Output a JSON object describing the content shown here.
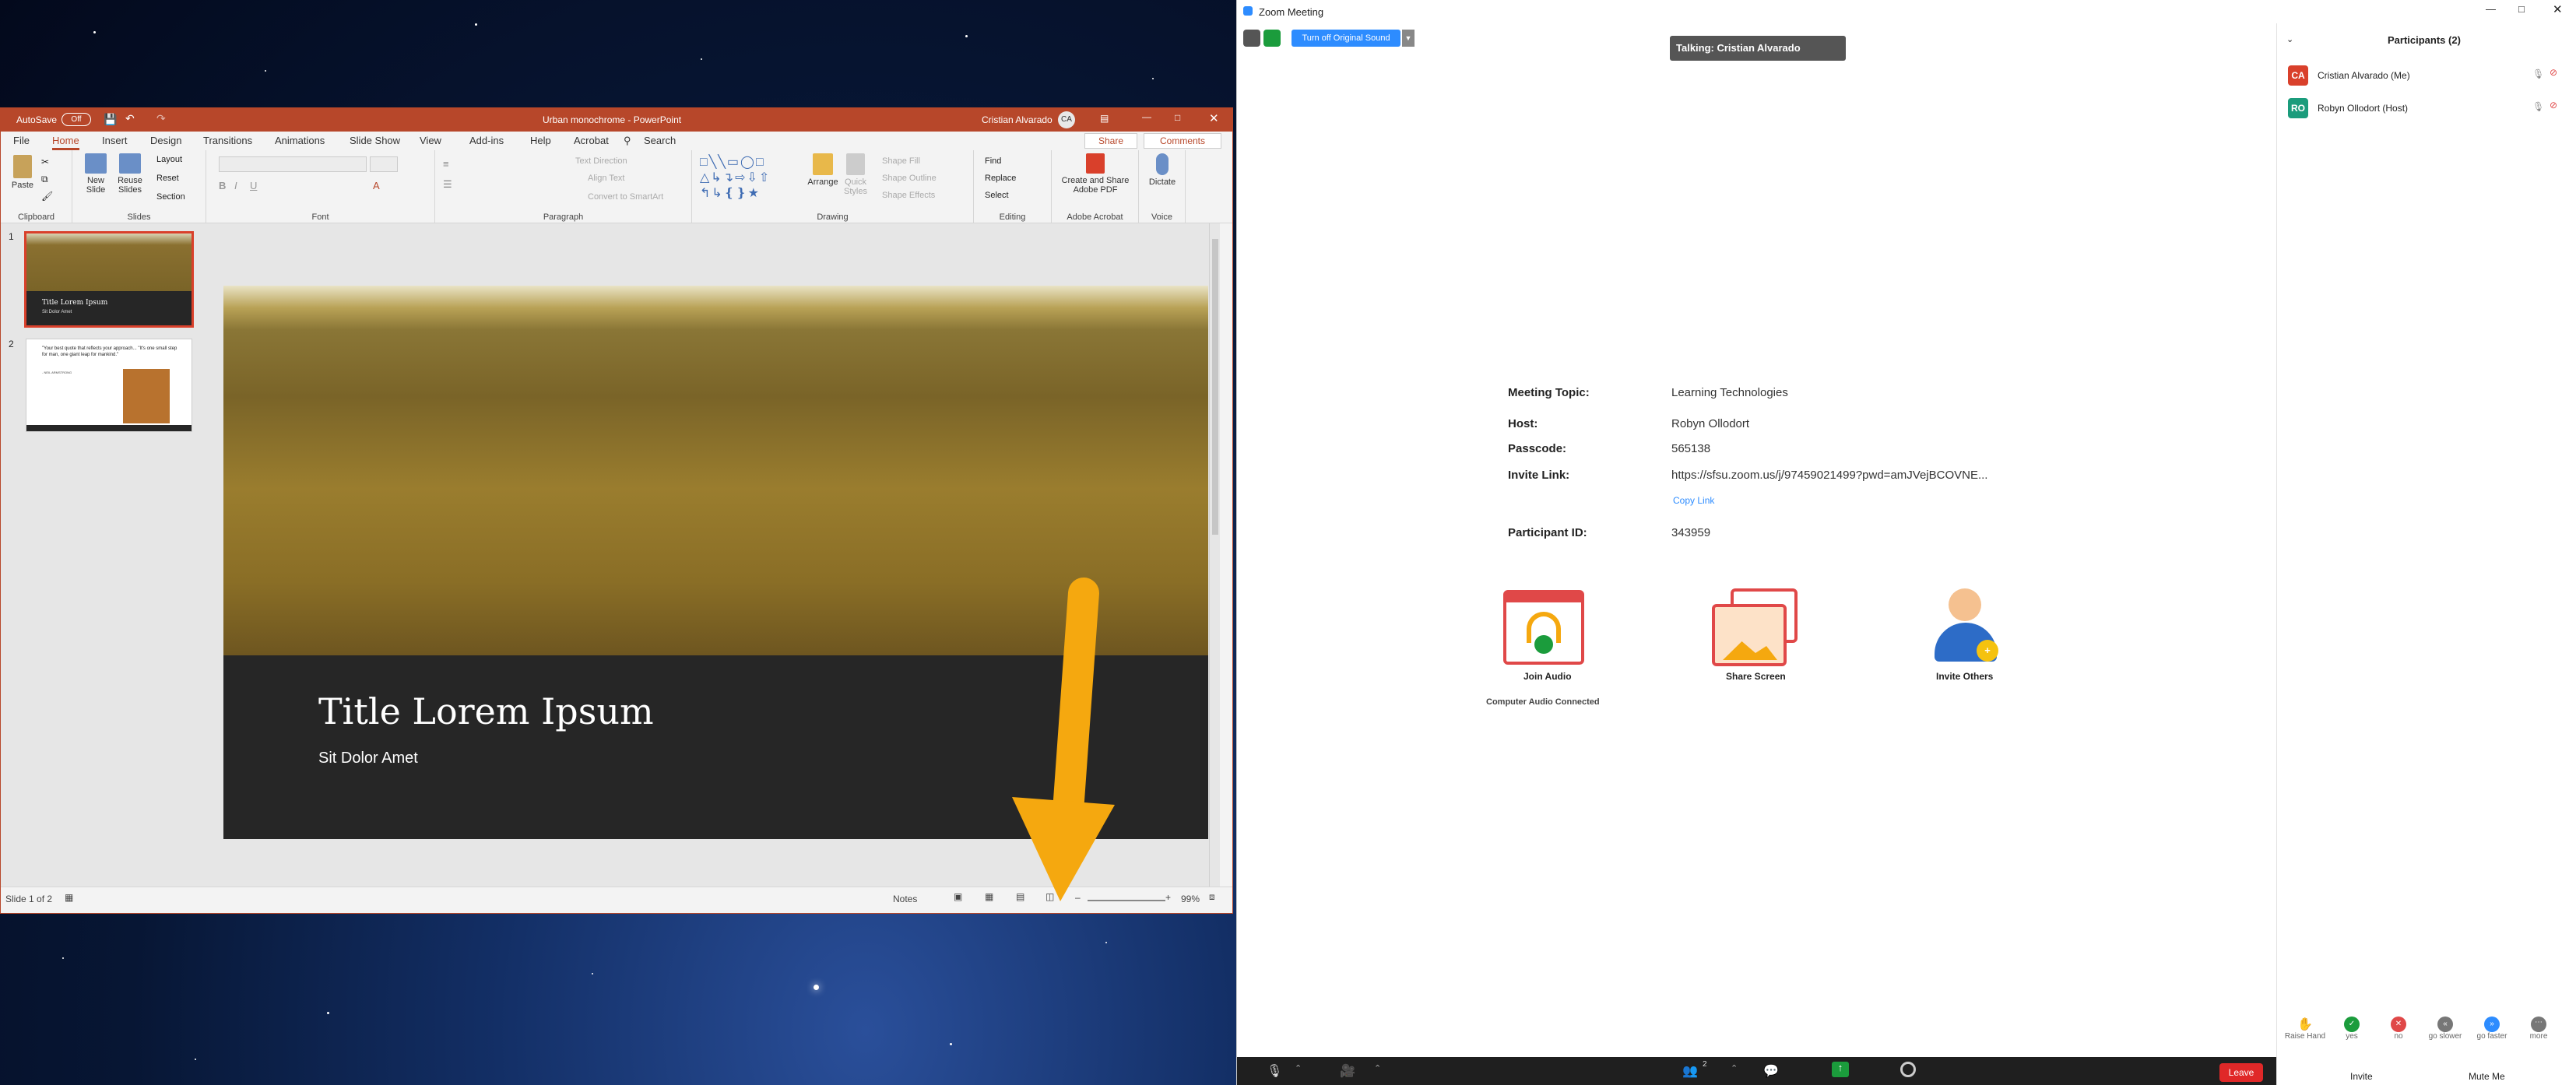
{
  "powerpoint": {
    "autosave_label": "AutoSave",
    "autosave_state": "Off",
    "title": "Urban monochrome  -  PowerPoint",
    "user": "Cristian Alvarado",
    "user_initials": "CA",
    "tabs": [
      "File",
      "Home",
      "Insert",
      "Design",
      "Transitions",
      "Animations",
      "Slide Show",
      "View",
      "Add-ins",
      "Help",
      "Acrobat"
    ],
    "search": "Search",
    "share": "Share",
    "comments": "Comments",
    "groups": {
      "clipboard": "Clipboard",
      "paste": "Paste",
      "slides": "Slides",
      "new_slide": "New Slide",
      "reuse_slides": "Reuse Slides",
      "layout": "Layout",
      "reset": "Reset",
      "section": "Section",
      "font": "Font",
      "paragraph": "Paragraph",
      "text_direction": "Text Direction",
      "align_text": "Align Text",
      "convert_smartart": "Convert to SmartArt",
      "drawing": "Drawing",
      "arrange": "Arrange",
      "quick_styles": "Quick Styles",
      "shape_fill": "Shape Fill",
      "shape_outline": "Shape Outline",
      "shape_effects": "Shape Effects",
      "editing": "Editing",
      "find": "Find",
      "replace": "Replace",
      "select": "Select",
      "acrobat": "Adobe Acrobat",
      "create_share": "Create and Share Adobe PDF",
      "voice": "Voice",
      "dictate": "Dictate"
    },
    "thumbs": [
      {
        "num": "1",
        "title": "Title Lorem Ipsum",
        "sub": "Sit Dolor Amet"
      },
      {
        "num": "2",
        "quote": "\"Your best quote that reflects your approach... \"It's one small step for man, one giant leap for mankind.\"",
        "author": "- NEIL ARMSTRONG"
      }
    ],
    "slide_title": "Title Lorem Ipsum",
    "slide_subtitle": "Sit Dolor Amet",
    "status_slide": "Slide 1 of 2",
    "notes": "Notes",
    "zoom": "99%"
  },
  "zoom": {
    "window_title": "Zoom Meeting",
    "original_sound": "Turn off Original Sound",
    "talking": "Talking: Cristian Alvarado",
    "meeting_topic_label": "Meeting Topic:",
    "meeting_topic": "Learning Technologies",
    "host_label": "Host:",
    "host": "Robyn Ollodort",
    "passcode_label": "Passcode:",
    "passcode": "565138",
    "invite_link_label": "Invite Link:",
    "invite_link": "https://sfsu.zoom.us/j/97459021499?pwd=amJVejBCOVNE...",
    "copy_link": "Copy Link",
    "participant_id_label": "Participant ID:",
    "participant_id": "343959",
    "join_audio": "Join Audio",
    "audio_connected": "Computer Audio Connected",
    "share_screen": "Share Screen",
    "invite_others": "Invite Others",
    "participants_title": "Participants (2)",
    "participants": [
      {
        "initials": "CA",
        "name": "Cristian Alvarado (Me)",
        "color": "#d9402b"
      },
      {
        "initials": "RO",
        "name": "Robyn Ollodort (Host)",
        "color": "#1b9c7c"
      }
    ],
    "reactions": [
      "Raise Hand",
      "yes",
      "no",
      "go slower",
      "go faster",
      "more"
    ],
    "invite": "Invite",
    "mute_me": "Mute Me",
    "participant_count": "2",
    "leave": "Leave"
  }
}
